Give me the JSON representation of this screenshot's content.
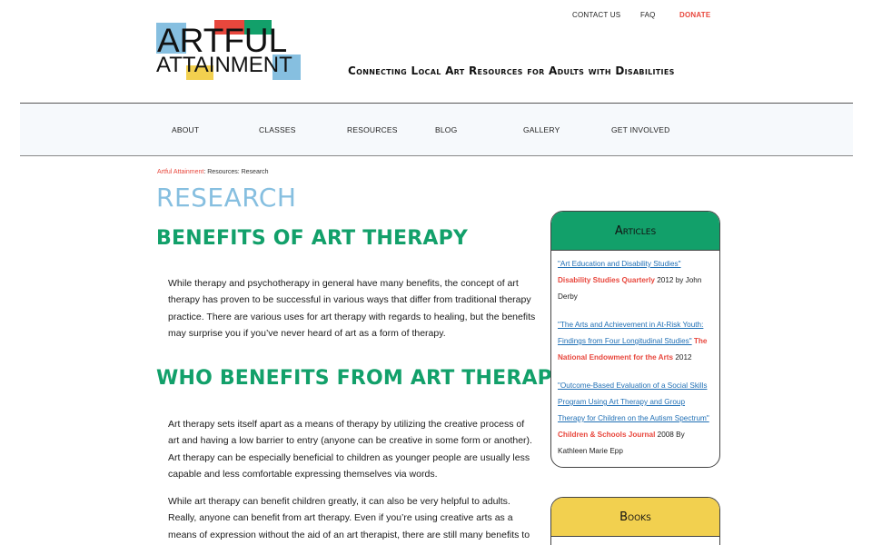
{
  "logo": {
    "line1": "ARTFUL",
    "line2": "ATTAINMENT",
    "colors": {
      "blue": "#86bfe0",
      "red": "#e8473d",
      "green": "#12a06a",
      "yellow": "#f2d04f"
    }
  },
  "topnav": {
    "contact": "CONTACT US",
    "faq": "FAQ",
    "donate": "DONATE"
  },
  "tagline": "Connecting Local Art Resources for Adults with Disabilities",
  "nav": [
    "ABOUT",
    "CLASSES",
    "RESOURCES",
    "BLOG",
    "GALLERY",
    "GET INVOLVED"
  ],
  "breadcrumb": {
    "home": "Artful Attainment",
    "rest": ": Resources: Research"
  },
  "page_title": "RESEARCH",
  "sections": [
    {
      "heading": "BENEFITS OF ART THERAPY",
      "paragraphs": [
        "While therapy and psychotherapy in general have many benefits, the concept of art therapy has proven to be successful in various ways that differ from traditional therapy practice. There are various uses for art therapy with regards to healing, but the benefits may surprise you if you’ve never heard of art as a form of therapy."
      ]
    },
    {
      "heading": "WHO BENEFITS FROM ART THERAPY?",
      "paragraphs": [
        "Art therapy sets itself apart as a means of therapy by utilizing the creative process of art and having a low barrier to entry (anyone can be creative in some form or another). Art therapy can be especially beneficial to children as younger people are usually less capable and less comfortable expressing themselves via words.",
        "While art therapy can benefit children greatly, it can also be very helpful to adults. Really, anyone can benefit from art therapy. Even if you’re using creative arts as a means of expression without the aid of an art therapist, there are still many benefits to"
      ]
    }
  ],
  "articles_card": {
    "title": "Articles",
    "head_color": "#12a06a",
    "items": [
      {
        "link": "\"Art Education and Disability Studies\"",
        "pub": "Disability Studies Quarterly",
        "tail": " 2012 by John Derby"
      },
      {
        "link": "\"The Arts and Achievement in At-Risk Youth: Findings from Four Longitudinal Studies\"",
        "pub": "The National Endowment for the Arts",
        "tail": " 2012"
      },
      {
        "link": "\"Outcome-Based Evaluation of a Social Skills Program Using Art Therapy and Group Therapy for Children on the Autism Spectrum\"",
        "pub": "Children & Schools Journal",
        "tail": " 2008 By Kathleen Marie Epp"
      }
    ]
  },
  "books_card": {
    "title": "Books",
    "head_color": "#f2d04f"
  }
}
